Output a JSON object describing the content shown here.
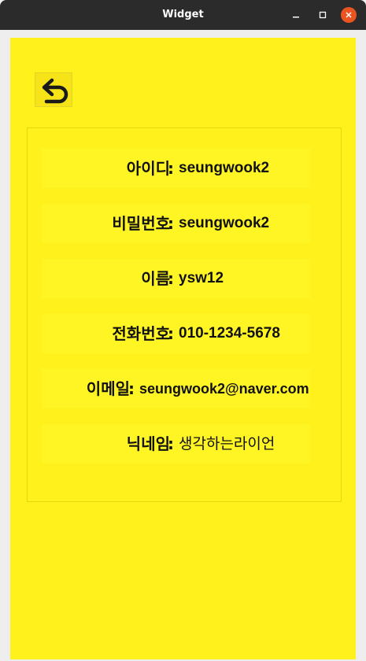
{
  "window": {
    "title": "Widget",
    "minimize_icon": "minimize-icon",
    "maximize_icon": "maximize-icon",
    "close_icon": "close-icon"
  },
  "back_button": {
    "icon": "undo-arrow-icon"
  },
  "profile": {
    "fields": [
      {
        "label": "아이디",
        "colon": ":",
        "value": "seungwook2"
      },
      {
        "label": "비밀번호",
        "colon": ":",
        "value": "seungwook2"
      },
      {
        "label": "이름",
        "colon": ":",
        "value": "ysw12"
      },
      {
        "label": "전화번호",
        "colon": ":",
        "value": "010-1234-5678"
      },
      {
        "label": "이메일",
        "colon": ":",
        "value": "seungwook2@naver.com"
      },
      {
        "label": "닉네임",
        "colon": ":",
        "value": "생각하는라이언"
      }
    ]
  },
  "colors": {
    "panel_bg": "#fff21c",
    "titlebar_bg": "#2b2b2b",
    "close_btn": "#e95420"
  }
}
